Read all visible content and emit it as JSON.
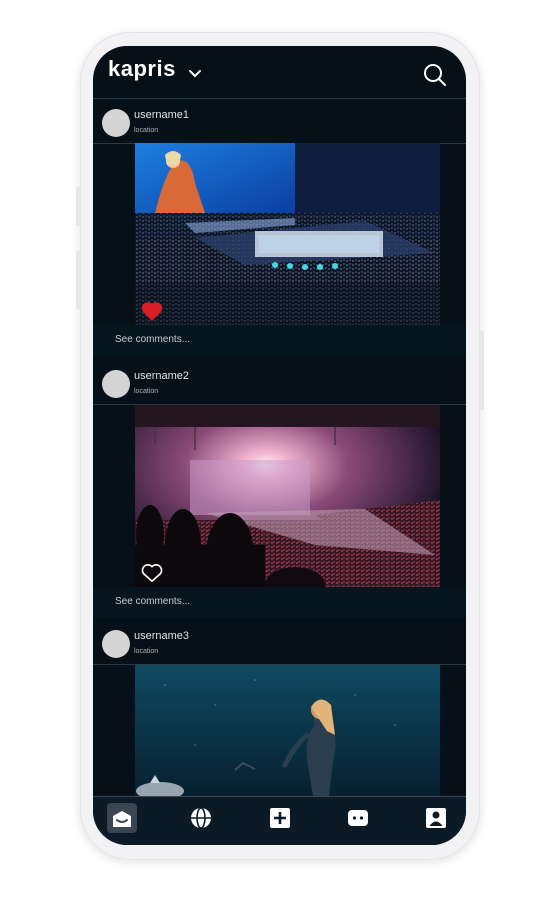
{
  "app": {
    "logo": "kapris"
  },
  "posts": [
    {
      "username": "username1",
      "location": "location",
      "liked": true,
      "comments_label": "See comments..."
    },
    {
      "username": "username2",
      "location": "location",
      "liked": false,
      "comments_label": "See comments..."
    },
    {
      "username": "username3",
      "location": "location"
    }
  ],
  "nav": {
    "items": [
      "home-icon",
      "globe-icon",
      "add-icon",
      "chat-icon",
      "profile-icon"
    ],
    "active": "home-icon"
  },
  "colors": {
    "background": "#061019",
    "like": "#d81f26",
    "divider": "#2b3a44"
  }
}
